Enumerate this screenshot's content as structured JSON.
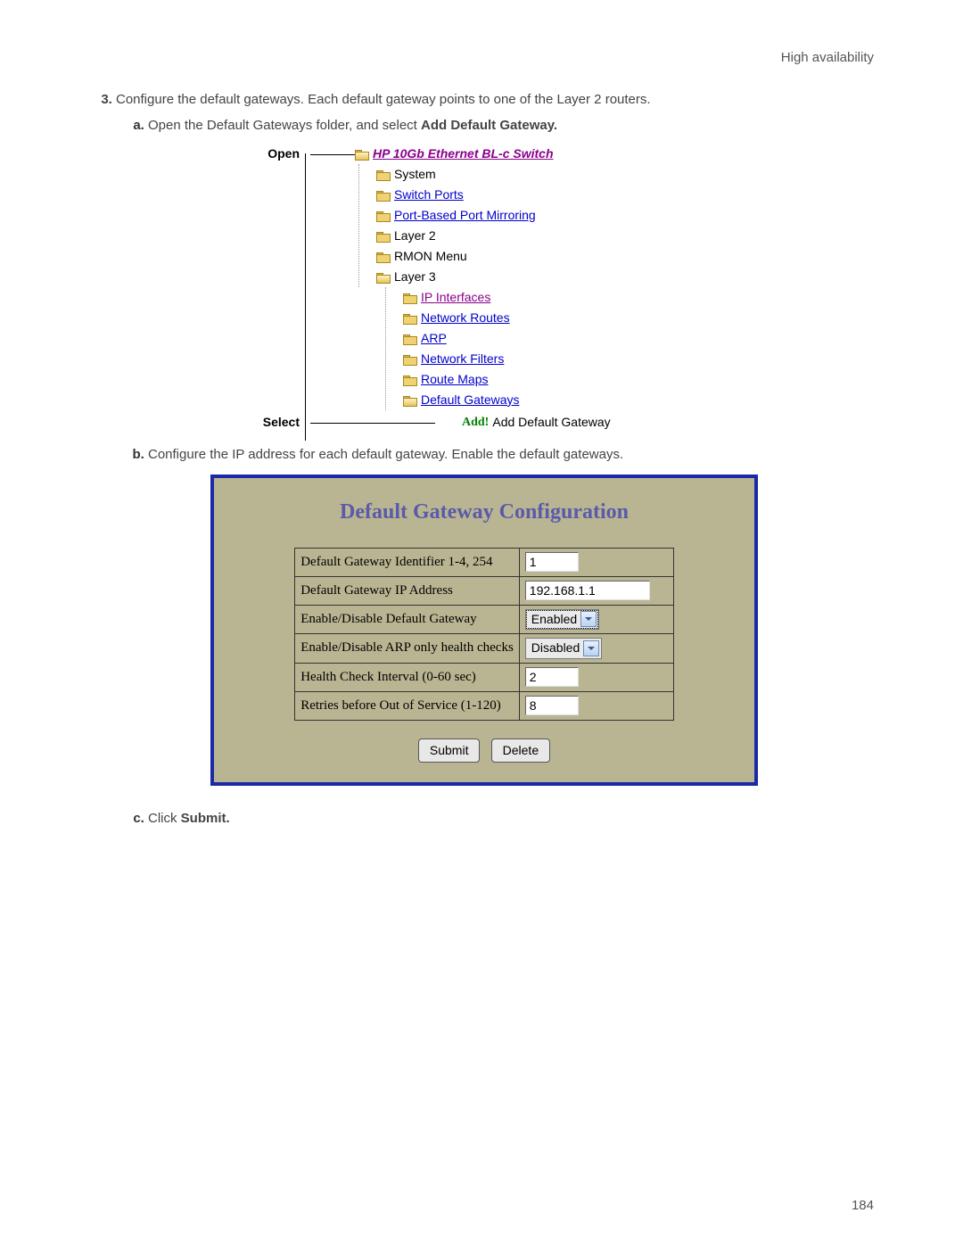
{
  "header": {
    "section": "High availability"
  },
  "list": {
    "item3_number": "3.",
    "item3_text": "Configure the default gateways. Each default gateway points to one of the Layer 2 routers.",
    "sub_a_prefix": "Open the Default Gateways folder, and select ",
    "sub_a_bold": "Add Default Gateway.",
    "sub_b": "Configure the IP address for each default gateway. Enable the default gateways.",
    "sub_c_prefix": "Click ",
    "sub_c_bold": "Submit."
  },
  "tree": {
    "open_label": "Open",
    "select_label": "Select",
    "root": "HP 10Gb Ethernet BL-c Switch",
    "n_system": "System",
    "n_switch_ports": "Switch Ports",
    "n_port_mirror": "Port-Based Port Mirroring",
    "n_layer2": "Layer 2",
    "n_rmon": "RMON Menu",
    "n_layer3": "Layer 3",
    "n_ip_if": "IP Interfaces",
    "n_net_routes": "Network Routes",
    "n_arp": "ARP",
    "n_net_filters": "Network Filters",
    "n_route_maps": "Route Maps",
    "n_def_gw": "Default Gateways",
    "add_word": "Add!",
    "add_text": "Add Default Gateway"
  },
  "config": {
    "title": "Default Gateway Configuration",
    "rows": {
      "id_label": "Default Gateway Identifier 1-4, 254",
      "id_value": "1",
      "ip_label": "Default Gateway IP Address",
      "ip_value": "192.168.1.1",
      "enable_label": "Enable/Disable Default Gateway",
      "enable_value": "Enabled",
      "arp_label": "Enable/Disable ARP only health checks",
      "arp_value": "Disabled",
      "interval_label": "Health Check Interval (0-60 sec)",
      "interval_value": "2",
      "retries_label": "Retries before Out of Service (1-120)",
      "retries_value": "8"
    },
    "submit": "Submit",
    "delete": "Delete"
  },
  "footer": {
    "page": "184"
  }
}
